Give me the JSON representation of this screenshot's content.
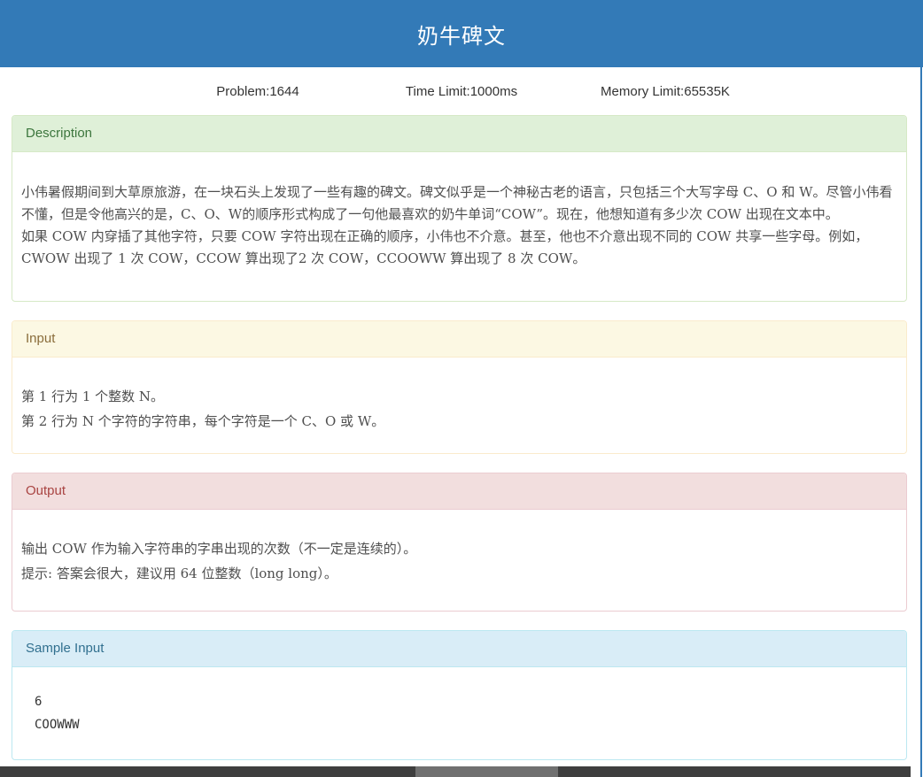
{
  "page": {
    "title": "奶牛碑文",
    "meta": {
      "problem": "Problem:1644",
      "time_limit": "Time Limit:1000ms",
      "memory_limit": "Memory Limit:65535K"
    }
  },
  "panels": {
    "description": {
      "heading": "Description",
      "paragraphs": [
        "小伟暑假期间到大草原旅游，在一块石头上发现了一些有趣的碑文。碑文似乎是一个神秘古老的语言，只包括三个大写字母 C、O 和 W。尽管小伟看不懂，但是令他高兴的是，C、O、W的顺序形式构成了一句他最喜欢的奶牛单词“COW”。现在，他想知道有多少次 COW 出现在文本中。",
        "如果 COW 内穿插了其他字符，只要 COW 字符出现在正确的顺序，小伟也不介意。甚至，他也不介意出现不同的 COW 共享一些字母。例如，CWOW 出现了 1 次 COW，CCOW 算出现了2 次 COW，CCOOWW 算出现了 8 次 COW。"
      ]
    },
    "input": {
      "heading": "Input",
      "lines": [
        "第 1 行为 1 个整数 N。",
        "第 2 行为 N 个字符的字符串，每个字符是一个 C、O 或 W。"
      ]
    },
    "output": {
      "heading": "Output",
      "lines": [
        "输出 COW 作为输入字符串的字串出现的次数（不一定是连续的）。",
        "提示: 答案会很大，建议用 64 位整数（long long）。"
      ]
    },
    "sample_input": {
      "heading": "Sample Input",
      "content": "6\nCOOWWW"
    }
  },
  "colors": {
    "header_blue": "#337ab7",
    "success_bg": "#dff0d8",
    "success_text": "#3c763d",
    "warning_bg": "#fcf8e3",
    "warning_text": "#8a6d3b",
    "danger_bg": "#f2dede",
    "danger_text": "#a94442",
    "info_bg": "#d9edf7",
    "info_text": "#31708f",
    "scrollbar_track": "#3e3e3e",
    "scrollbar_thumb": "#707070"
  }
}
